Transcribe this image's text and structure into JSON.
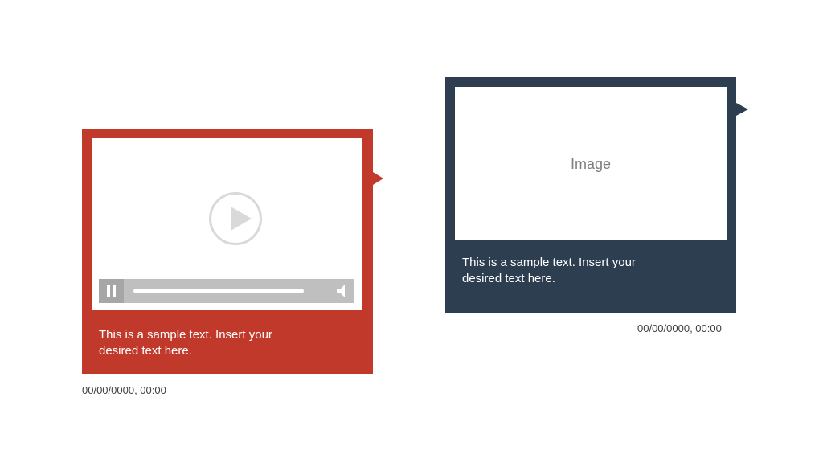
{
  "video_card": {
    "caption_line1": "This is a sample text. Insert your",
    "caption_line2": "desired text here.",
    "timestamp": "00/00/0000, 00:00",
    "color": "#c0392b",
    "icons": [
      "play-icon",
      "pause-icon",
      "volume-icon"
    ]
  },
  "image_card": {
    "image_label": "Image",
    "caption_line1": "This is a sample text. Insert your",
    "caption_line2": "desired text here.",
    "timestamp": "00/00/0000, 00:00",
    "color": "#2c3e50"
  }
}
